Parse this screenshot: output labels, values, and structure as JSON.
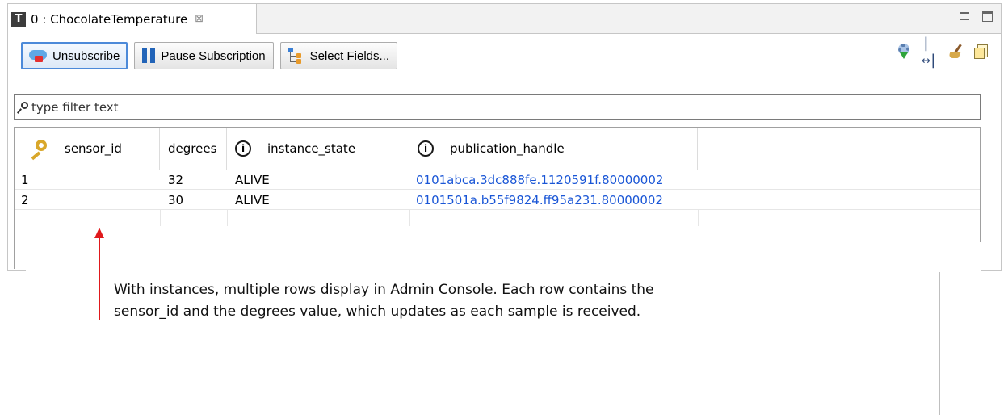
{
  "tab": {
    "icon_letter": "T",
    "title": "0 : ChocolateTemperature",
    "close_glyph": "⊠"
  },
  "window_controls": {
    "minimize": "minimize-icon",
    "maximize": "maximize-icon"
  },
  "toolbar": {
    "unsubscribe_label": "Unsubscribe",
    "pause_label": "Pause Subscription",
    "select_fields_label": "Select Fields..."
  },
  "right_tools": [
    "refresh-gear-icon",
    "fit-columns-icon",
    "clear-broom-icon",
    "export-icon"
  ],
  "filter": {
    "placeholder": "type filter text",
    "value": ""
  },
  "table": {
    "columns": [
      "sensor_id",
      "degrees",
      "instance_state",
      "publication_handle"
    ],
    "rows": [
      {
        "sensor_id": "1",
        "degrees": "32",
        "instance_state": "ALIVE",
        "publication_handle": "0101abca.3dc888fe.1120591f.80000002"
      },
      {
        "sensor_id": "2",
        "degrees": "30",
        "instance_state": "ALIVE",
        "publication_handle": "0101501a.b55f9824.ff95a231.80000002"
      }
    ]
  },
  "callout": {
    "text": "With instances, multiple rows display in Admin Console. Each row contains the sensor_id and the degrees value, which updates as each sample is received.",
    "arrow_color": "#e0191c"
  },
  "colors": {
    "link": "#1a56d6",
    "focus_border": "#4c8ad9"
  }
}
